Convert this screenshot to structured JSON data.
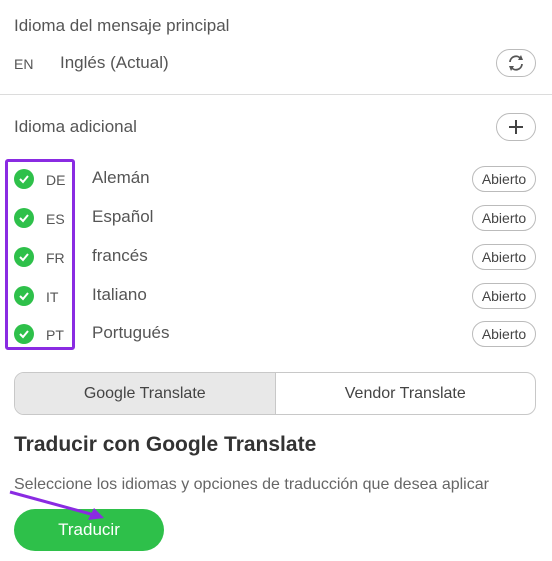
{
  "main_section": {
    "title": "Idioma del mensaje principal",
    "code": "EN",
    "language": "Inglés (Actual)"
  },
  "additional_section": {
    "title": "Idioma adicional",
    "languages": [
      {
        "code": "DE",
        "name": "Alemán",
        "status": "Abierto",
        "checked": true
      },
      {
        "code": "ES",
        "name": "Español",
        "status": "Abierto",
        "checked": true
      },
      {
        "code": "FR",
        "name": "francés",
        "status": "Abierto",
        "checked": true
      },
      {
        "code": "IT",
        "name": "Italiano",
        "status": "Abierto",
        "checked": true
      },
      {
        "code": "PT",
        "name": "Portugués",
        "status": "Abierto",
        "checked": true
      }
    ]
  },
  "tabs": {
    "google": "Google Translate",
    "vendor": "Vendor Translate",
    "active": "google"
  },
  "translate": {
    "heading": "Traducir con Google Translate",
    "description": "Seleccione los idiomas y opciones de traducción que desea aplicar",
    "button": "Traducir"
  },
  "colors": {
    "accent_green": "#2ec04a",
    "highlight_purple": "#8a2be2"
  }
}
